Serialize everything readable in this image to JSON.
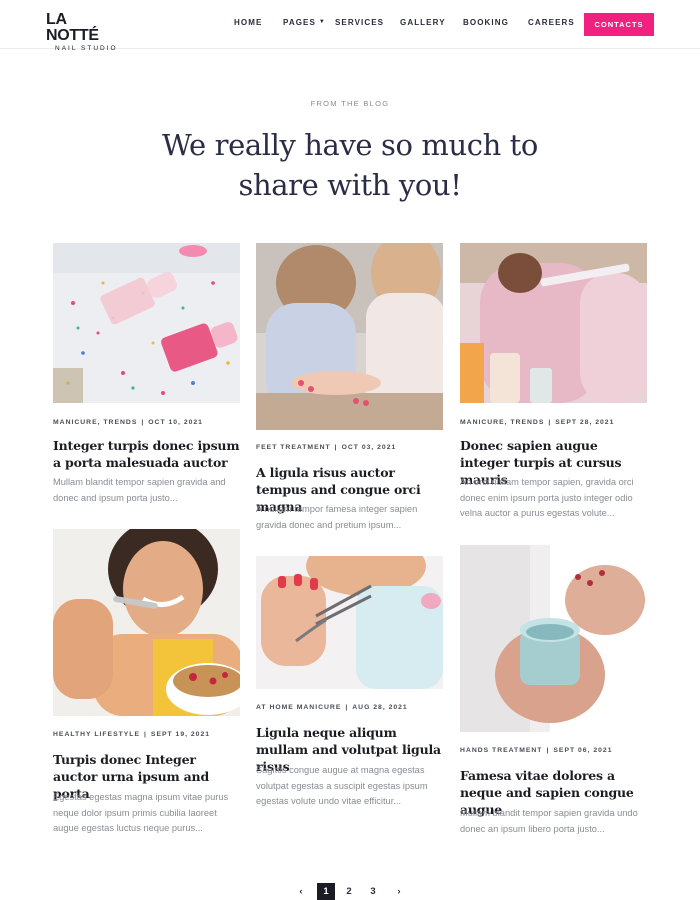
{
  "brand": {
    "name": "LA NOTTÉ",
    "tagline": "NAIL STUDIO"
  },
  "nav": {
    "items": [
      {
        "label": "HOME"
      },
      {
        "label": "PAGES",
        "has_dropdown": true
      },
      {
        "label": "SERVICES"
      },
      {
        "label": "GALLERY"
      },
      {
        "label": "BOOKING"
      },
      {
        "label": "CAREERS"
      }
    ],
    "cta": "CONTACTS",
    "cta_color": "#f0217f"
  },
  "section": {
    "eyebrow": "FROM THE BLOG",
    "title_line1": "We really have so much to",
    "title_line2": "share with you!"
  },
  "posts": [
    {
      "category": "MANICURE, TRENDS",
      "date": "OCT 10, 2021",
      "title": "Integer turpis donec ipsum a porta malesuada auctor",
      "excerpt": "Mullam blandit tempor sapien gravida and donec and ipsum porta justo...",
      "image": "nail-polish-confetti"
    },
    {
      "category": "FEET TREATMENT",
      "date": "OCT 03, 2021",
      "title": "A ligula risus auctor tempus and congue orci magna",
      "excerpt": "A nullam tempor famesa integer sapien gravida donec and pretium ipsum...",
      "image": "pedicure-friends"
    },
    {
      "category": "MANICURE, TRENDS",
      "date": "SEPT 28, 2021",
      "title": "Donec sapien augue integer turpis at cursus mauris",
      "excerpt": "An orci nullam tempor sapien, gravida orci donec enim ipsum porta justo integer odio velna auctor a purus egestas volute...",
      "image": "nail-filing-pajamas"
    },
    {
      "category": "HEALTHY LIFESTYLE",
      "date": "SEPT 19, 2021",
      "title": "Turpis donec Integer auctor urna ipsum and porta",
      "excerpt": "Egestas egestas magna ipsum vitae purus neque dolor ipsum primis cubilia laoreet augue egestas luctus neque purus...",
      "image": "woman-eating-granola"
    },
    {
      "category": "AT HOME MANICURE",
      "date": "AUG 28, 2021",
      "title": "Ligula neque aliqum mullam and volutpat ligula risus",
      "excerpt": "Sagittis congue augue at magna egestas volutpat egestas a suscipit egestas ipsum egestas volute undo vitae efficitur...",
      "image": "cuticle-nipper"
    },
    {
      "category": "HANDS TREATMENT",
      "date": "SEPT 06, 2021",
      "title": "Famesa vitae dolores a neque and sapien congue augue",
      "excerpt": "Mullam blandit tempor sapien gravida undo donec an ipsum libero porta justo...",
      "image": "hand-cream-jar"
    }
  ],
  "pagination": {
    "prev": "‹",
    "pages": [
      "1",
      "2",
      "3"
    ],
    "current": "1",
    "next": "›"
  }
}
